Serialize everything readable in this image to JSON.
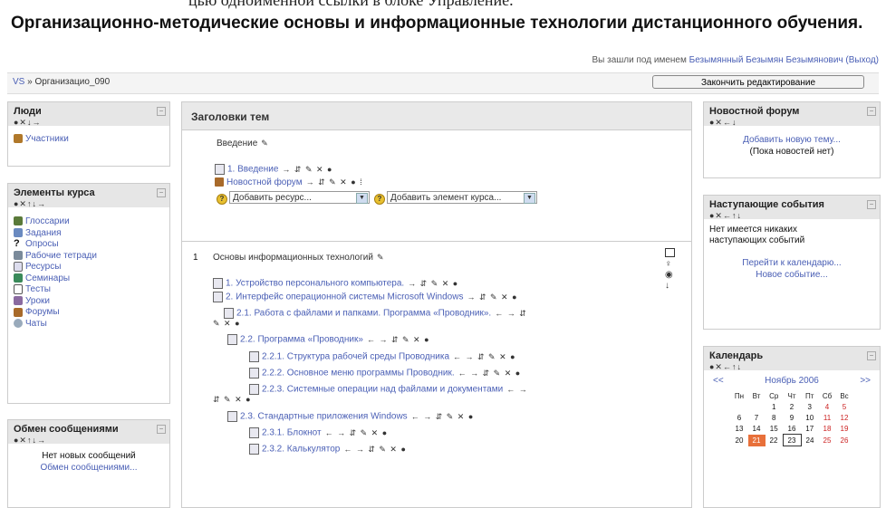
{
  "top_fragment": "цью одноименной ссылки в блоке Управление.",
  "course_title": "Организационно-методические основы и информационные технологии дистанционного обучения.",
  "login": {
    "prefix": "Вы зашли под именем",
    "user": "Безымянный Безымян Безымянович",
    "logout": "(Выход)"
  },
  "breadcrumb": {
    "root": "VS",
    "sep": "»",
    "current": "Организацио_090"
  },
  "edit_button": "Закончить редактирование",
  "left": {
    "people": {
      "title": "Люди",
      "ctrls": "●✕↓→",
      "items": [
        "Участники"
      ]
    },
    "elements": {
      "title": "Элементы курса",
      "ctrls": "●✕↑↓→",
      "items": [
        "Глоссарии",
        "Задания",
        "Опросы",
        "Рабочие тетради",
        "Ресурсы",
        "Семинары",
        "Тесты",
        "Уроки",
        "Форумы",
        "Чаты"
      ]
    },
    "messages": {
      "title": "Обмен сообщениями",
      "ctrls": "●✕↑↓→",
      "lines": [
        "Нет новых сообщений",
        "Обмен сообщениями..."
      ]
    }
  },
  "main": {
    "header": "Заголовки тем",
    "intro": "Введение",
    "sec0_items": [
      "1. Введение",
      "Новостной форум"
    ],
    "add_resource": "Добавить ресурс...",
    "add_activity": "Добавить элемент курса...",
    "sec1_num": "1",
    "sec1_title": "Основы информационных технологий",
    "sec1_items": [
      "1. Устройство персонального компьютера.",
      "2. Интерфейс операционной системы Microsoft Windows",
      "2.1. Работа с файлами и папками. Программа «Проводник».",
      "2.2. Программа «Проводник»",
      "2.2.1. Структура рабочей среды Проводника",
      "2.2.2. Основное меню программы Проводник.",
      "2.2.3. Системные операции над файлами и документами",
      "2.3. Стандартные приложения Windows",
      "2.3.1. Блокнот",
      "2.3.2. Калькулятор"
    ]
  },
  "right": {
    "news": {
      "title": "Новостной форум",
      "ctrls": "●✕←↓",
      "add": "Добавить новую тему...",
      "none": "(Пока новостей нет)"
    },
    "events": {
      "title": "Наступающие события",
      "ctrls": "●✕←↑↓",
      "text": "Нет имеется никаких наступающих событий",
      "link1": "Перейти к календарю...",
      "link2": "Новое событие..."
    },
    "calendar": {
      "title": "Календарь",
      "ctrls": "●✕←↑↓",
      "prev": "<<",
      "month": "Ноябрь 2006",
      "next": ">>",
      "days": [
        "Пн",
        "Вт",
        "Ср",
        "Чт",
        "Пт",
        "Сб",
        "Вс"
      ],
      "weeks": [
        [
          "",
          "",
          "1",
          "2",
          "3",
          "4",
          "5"
        ],
        [
          "6",
          "7",
          "8",
          "9",
          "10",
          "11",
          "12"
        ],
        [
          "13",
          "14",
          "15",
          "16",
          "17",
          "18",
          "19"
        ],
        [
          "20",
          "21",
          "22",
          "23",
          "24",
          "25",
          "26"
        ]
      ],
      "highlight_day": "21",
      "boxed_day": "23"
    }
  },
  "colors": {
    "link": "#4a5fb5",
    "header_bg": "#e6e6e6",
    "highlight": "#e8703a"
  }
}
